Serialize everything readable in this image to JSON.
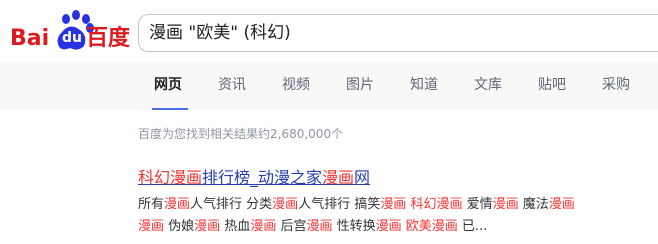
{
  "logo": {
    "text_left": "Bai",
    "text_mid": "du",
    "text_right": "百度"
  },
  "search": {
    "query": "漫画 \"欧美\" (科幻)"
  },
  "tabs": [
    {
      "label": "网页",
      "active": true
    },
    {
      "label": "资讯"
    },
    {
      "label": "视频"
    },
    {
      "label": "图片"
    },
    {
      "label": "知道"
    },
    {
      "label": "文库"
    },
    {
      "label": "贴吧"
    },
    {
      "label": "采购"
    }
  ],
  "stats": "百度为您找到相关结果约2,680,000个",
  "result": {
    "title_parts": [
      "科幻漫画",
      "排行榜_动漫之家",
      "漫画",
      "网"
    ],
    "snippet_line1": [
      "所有",
      "漫画",
      "人气排行 分类",
      "漫画",
      "人气排行 搞笑",
      "漫画",
      " ",
      "科幻漫画",
      " 爱情",
      "漫画",
      " 魔法",
      "漫画"
    ],
    "snippet_line2": [
      "漫画",
      " 伪娘",
      "漫画",
      " 热血",
      "漫画",
      " 后宫",
      "漫画",
      " 性转换",
      "漫画",
      " ",
      "欧美漫画",
      " 已..."
    ]
  }
}
